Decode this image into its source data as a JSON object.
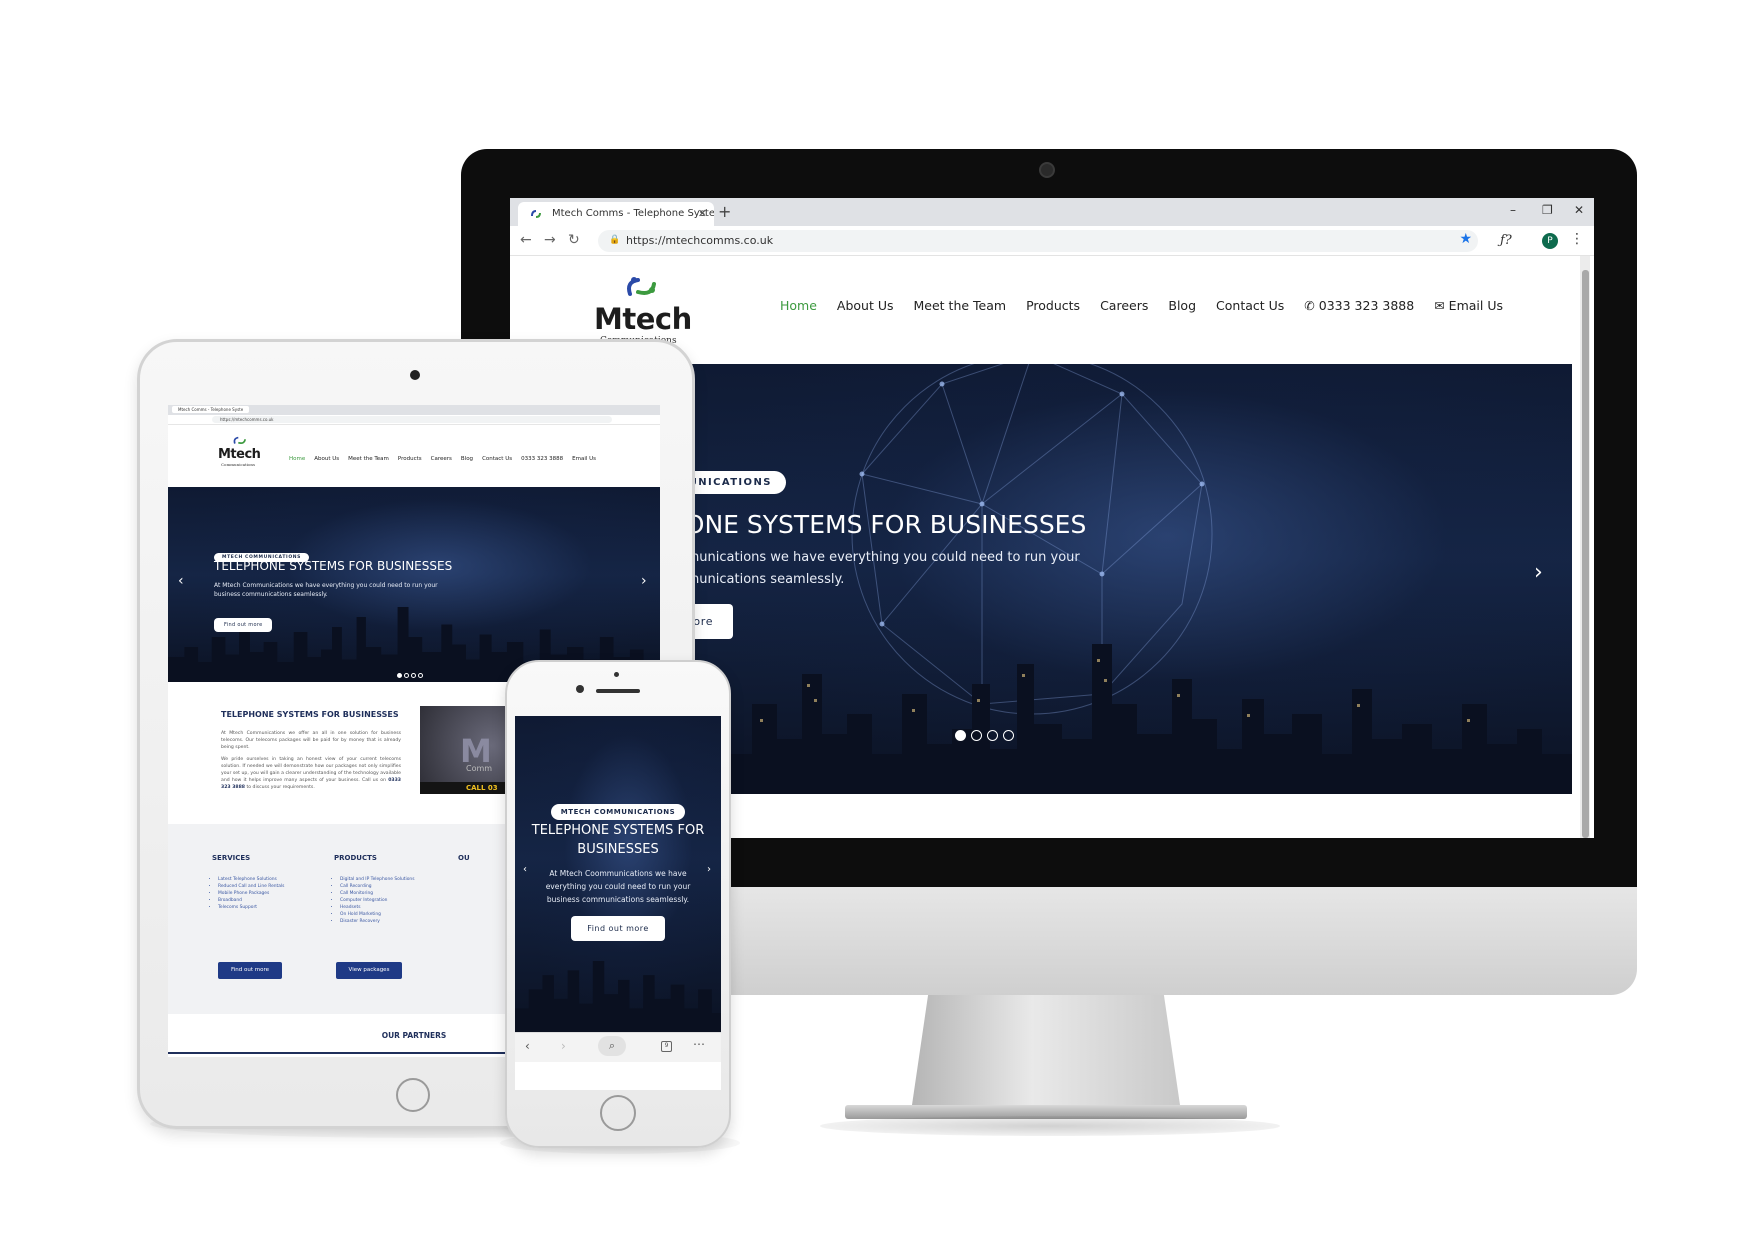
{
  "colors": {
    "nav_active": "#3c9a3f",
    "brand_navy": "#1f2f5b",
    "button_blue": "#1f3a86",
    "hero_dark": "#0f1a33"
  },
  "browser": {
    "tab_title": "Mtech Comms - Telephone Syste",
    "tab_close_icon": "close-icon",
    "new_tab": "+",
    "url": "https://mtechcomms.co.uk",
    "profile_initial": "P",
    "extension_label": "ƒ?",
    "window_controls": [
      "–",
      "❐",
      "✕"
    ]
  },
  "site": {
    "logo_word": "Mtech",
    "logo_sub": "Communications",
    "nav": {
      "home": "Home",
      "about": "About Us",
      "team": "Meet the Team",
      "products": "Products",
      "careers": "Careers",
      "blog": "Blog",
      "contact": "Contact Us",
      "phone": "0333 323 3888",
      "email": "Email Us"
    },
    "hero": {
      "pill": "MTECH COMMUNICATIONS",
      "title": "TELEPHONE SYSTEMS FOR BUSINESSES",
      "subtitle": "At Mtech Communications we have everything you could need to run your business communications seamlessly.",
      "button": "Find out more",
      "slides": 4,
      "active_slide": 1
    },
    "desktop_visible": {
      "pill": "MMUNICATIONS",
      "title": "HONE SYSTEMS FOR BUSINESSES",
      "sub_line1": "ommunications we have everything you could need to run your",
      "sub_line2": "ommunications seamlessly.",
      "button": "more"
    },
    "about": {
      "heading": "TELEPHONE SYSTEMS FOR BUSINESSES",
      "para1": "At Mtech Communications we offer an all in one solution for business telecoms. Our telecoms packages will be paid for by money that is already being spent.",
      "para2_pre": "We pride ourselves in taking an honest view of your current telecoms solution. If needed we will demonstrate how our packages not only simplifies your set up, you will gain a clearer understanding of the technology available and how it helps improve many aspects of your business.  Call us on",
      "para2_phone": "0333 323 3888",
      "para2_post": "to discuss your requirements.",
      "video_text_m": "M",
      "video_text_comm": "Comm",
      "video_call": "CALL 03"
    },
    "services": {
      "heading": "SERVICES",
      "items": [
        "Latest Telephone Solutions",
        "Reduced Call and Line Rentals",
        "Mobile Phone Packages",
        "Broadband",
        "Telecoms Support"
      ],
      "button": "Find out more"
    },
    "products": {
      "heading": "PRODUCTS",
      "items": [
        "Digital and IP Telephone Solutions",
        "Call Recording",
        "Call Monitoring",
        "Computer Integration",
        "Headsets",
        "On Hold Marketing",
        "Disaster Recovery"
      ],
      "button": "View packages"
    },
    "third_col_heading": "OU",
    "partners": "OUR PARTNERS"
  },
  "phone": {
    "pill": "MTECH COMMUNICATIONS",
    "title_line1": "TELEPHONE SYSTEMS FOR",
    "title_line2": "BUSINESSES",
    "sub_line1": "At Mtech Coommunications we have",
    "sub_line2": "everything you could need to run your",
    "sub_line3": "business communications seamlessly.",
    "button": "Find out more",
    "tab_count": "9"
  }
}
